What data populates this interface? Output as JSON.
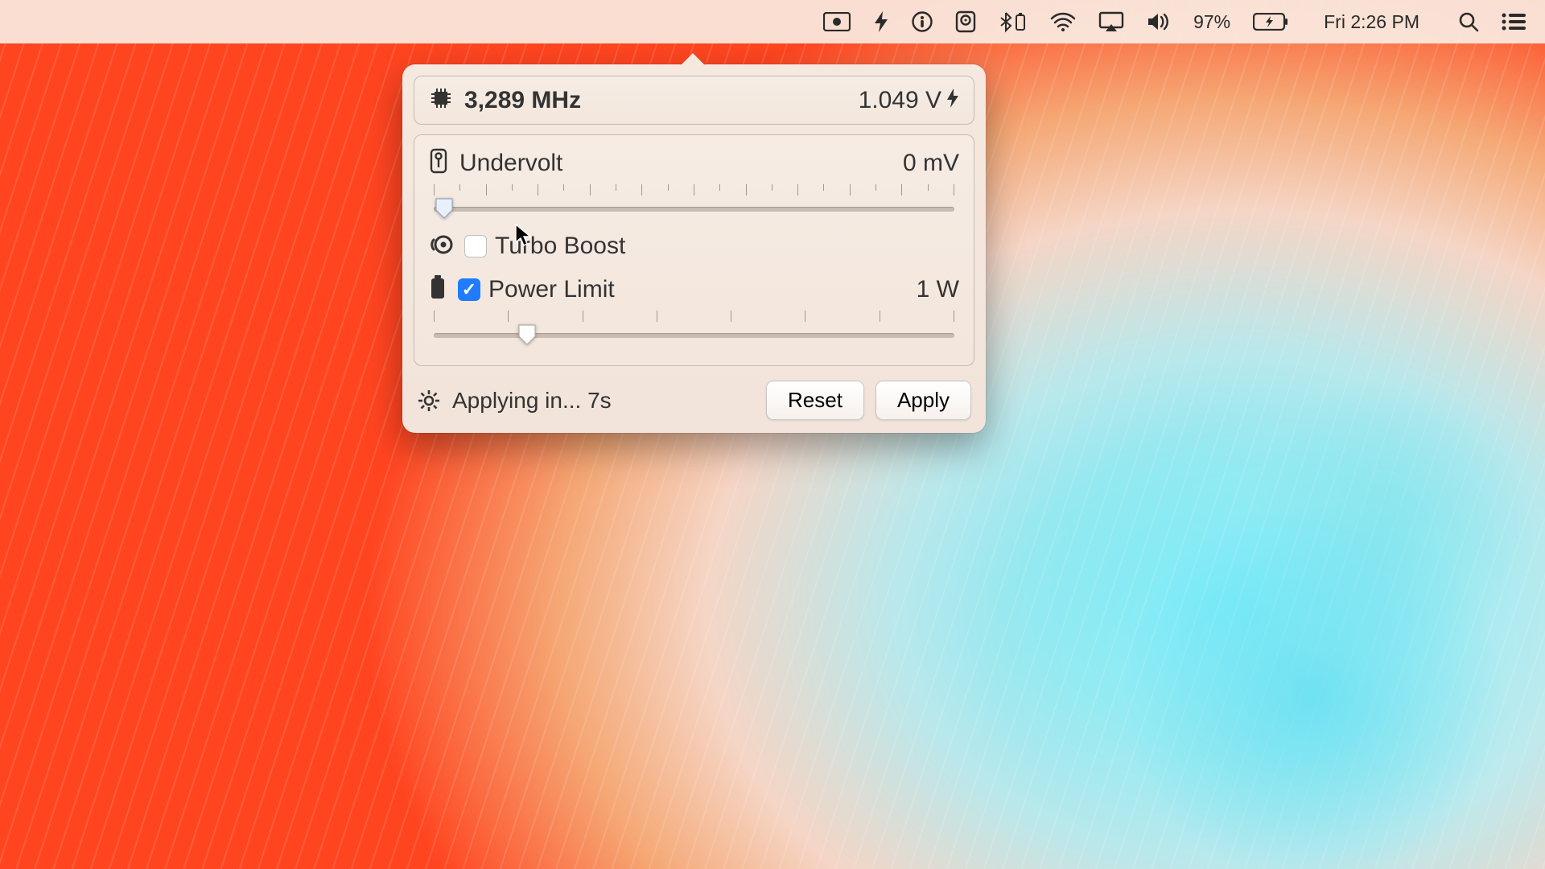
{
  "menubar": {
    "battery_percent": "97%",
    "clock": "Fri 2:26 PM"
  },
  "header": {
    "frequency": "3,289 MHz",
    "voltage": "1.049 V"
  },
  "undervolt": {
    "label": "Undervolt",
    "value": "0 mV",
    "slider_percent": 2
  },
  "turbo": {
    "label": "Turbo Boost",
    "checked": false
  },
  "power": {
    "label": "Power Limit",
    "value": "1 W",
    "checked": true,
    "slider_percent": 18
  },
  "footer": {
    "status": "Applying in... 7s",
    "reset_label": "Reset",
    "apply_label": "Apply"
  }
}
